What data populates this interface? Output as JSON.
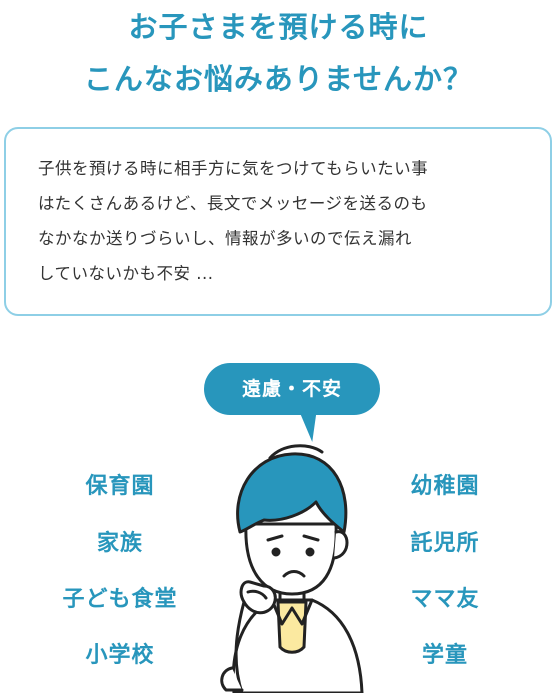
{
  "headline": {
    "line1": "お子さまを預ける時に",
    "line2": "こんなお悩みありませんか？"
  },
  "concern_box": {
    "lines": [
      "子供を預ける時に相手方に気をつけてもらいたい事",
      "はたくさんあるけど、長文でメッセージを送るのも",
      "なかなか送りづらいし、情報が多いので伝え漏れ",
      "していないかも不安 ..."
    ]
  },
  "bubble": {
    "label": "遠慮・不安"
  },
  "left_places": [
    "保育園",
    "家族",
    "子ども食堂",
    "小学校"
  ],
  "right_places": [
    "幼稚園",
    "託児所",
    "ママ友",
    "学童"
  ],
  "colors": {
    "accent": "#2896bc",
    "box_border": "#8ecfe6",
    "text": "#333333",
    "shirt_yellow": "#fbe9a0"
  },
  "illustration": {
    "icon": "worried-person-icon"
  }
}
